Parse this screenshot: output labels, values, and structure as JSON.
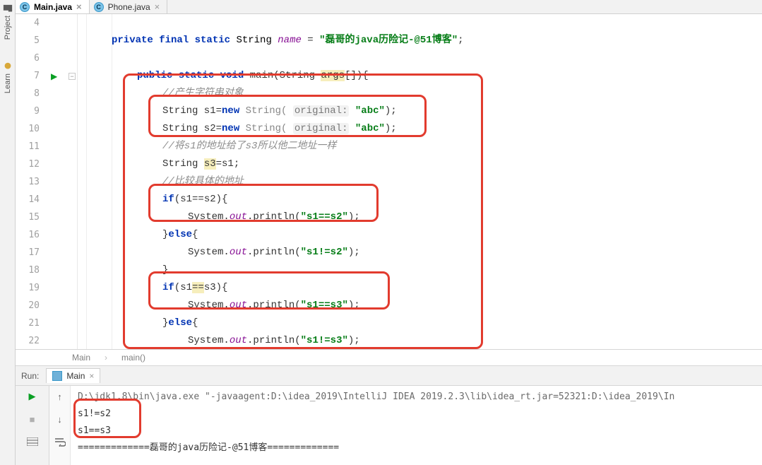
{
  "tabs": [
    {
      "label": "Main.java",
      "active": true
    },
    {
      "label": "Phone.java",
      "active": false
    }
  ],
  "side_tools": {
    "project": "Project",
    "learn": "Learn"
  },
  "gutter_lines": [
    "4",
    "5",
    "6",
    "7",
    "8",
    "9",
    "10",
    "11",
    "12",
    "13",
    "14",
    "15",
    "16",
    "17",
    "18",
    "19",
    "20",
    "21",
    "22"
  ],
  "code": {
    "l5": {
      "mods": "private final static",
      "type": "String",
      "name": "name",
      "eq": " = ",
      "val": "\"磊哥的java历险记-@51博客\"",
      "semi": ";"
    },
    "l7": {
      "mods": "public static void",
      "fn": "main",
      "sig": "(String ",
      "arg": "args",
      "sig2": "[]){",
      "argbg": "args"
    },
    "l8": "//产生字符串对象",
    "l9": {
      "pre": "String s1=",
      "kw": "new",
      "sp": " String( ",
      "hint": "original:",
      "sp2": " ",
      "val": "\"abc\"",
      "end": ");"
    },
    "l10": {
      "pre": "String s2=",
      "kw": "new",
      "sp": " String( ",
      "hint": "original:",
      "sp2": " ",
      "val": "\"abc\"",
      "end": ");"
    },
    "l11": "//将s1的地址给了s3所以他二地址一样",
    "l12": {
      "pre": "String ",
      "s3": "s3",
      "rest": "=s1;"
    },
    "l13": "//比较具体的地址",
    "l14": {
      "kw": "if",
      "cond": "(s1==s2){"
    },
    "l15": {
      "pre": "System.",
      "out": "out",
      "mid": ".println(",
      "val": "\"s1==s2\"",
      "end": ");"
    },
    "l16": {
      "close": "}",
      "kw": "else",
      "open": "{"
    },
    "l17": {
      "pre": "System.",
      "out": "out",
      "mid": ".println(",
      "val": "\"s1!=s2\"",
      "end": ");"
    },
    "l18": "}",
    "l19": {
      "kw": "if",
      "open": "(s1",
      "eq": "==",
      "rest": "s3){"
    },
    "l20": {
      "pre": "System.",
      "out": "out",
      "mid": ".println(",
      "val": "\"s1==s3\"",
      "end": ");"
    },
    "l21": {
      "close": "}",
      "kw": "else",
      "open": "{"
    },
    "l22": {
      "pre": "System.",
      "out": "out",
      "mid": ".println(",
      "val": "\"s1!=s3\"",
      "end": ");"
    }
  },
  "breadcrumb": {
    "a": "Main",
    "b": "main()"
  },
  "run": {
    "label": "Run:",
    "config": "Main",
    "cmd": "D:\\jdk1.8\\bin\\java.exe \"-javaagent:D:\\idea_2019\\IntelliJ IDEA 2019.2.3\\lib\\idea_rt.jar=52321:D:\\idea_2019\\In",
    "out1": "s1!=s2",
    "out2": "s1==s3",
    "out3": "=============磊哥的java历险记-@51博客============="
  }
}
